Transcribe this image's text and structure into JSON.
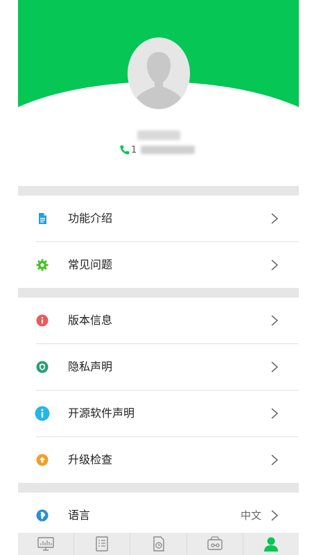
{
  "profile": {
    "phone_prefix": "1"
  },
  "menu": {
    "group1": [
      {
        "label": "功能介绍",
        "icon": "document-icon",
        "color": "#2a9be8"
      },
      {
        "label": "常见问题",
        "icon": "gear-icon",
        "color": "#4cbf2a"
      }
    ],
    "group2": [
      {
        "label": "版本信息",
        "icon": "info-icon",
        "color": "#ee5a5a"
      },
      {
        "label": "隐私声明",
        "icon": "shield-icon",
        "color": "#2a9e73"
      },
      {
        "label": "开源软件声明",
        "icon": "info-circle-icon",
        "color": "#22b6ea"
      },
      {
        "label": "升级检查",
        "icon": "upgrade-icon",
        "color": "#f0a02a"
      }
    ],
    "group3": [
      {
        "label": "语言",
        "icon": "globe-icon",
        "color": "#2a8fd8",
        "value": "中文"
      }
    ]
  },
  "tabs": [
    {
      "name": "monitor-tab",
      "icon": "monitor-icon"
    },
    {
      "name": "list-tab",
      "icon": "list-icon"
    },
    {
      "name": "report-tab",
      "icon": "report-icon"
    },
    {
      "name": "device-tab",
      "icon": "device-icon"
    },
    {
      "name": "profile-tab",
      "icon": "person-icon",
      "active": true
    }
  ],
  "colors": {
    "accent": "#06c755",
    "divider": "#e6e6e6"
  }
}
